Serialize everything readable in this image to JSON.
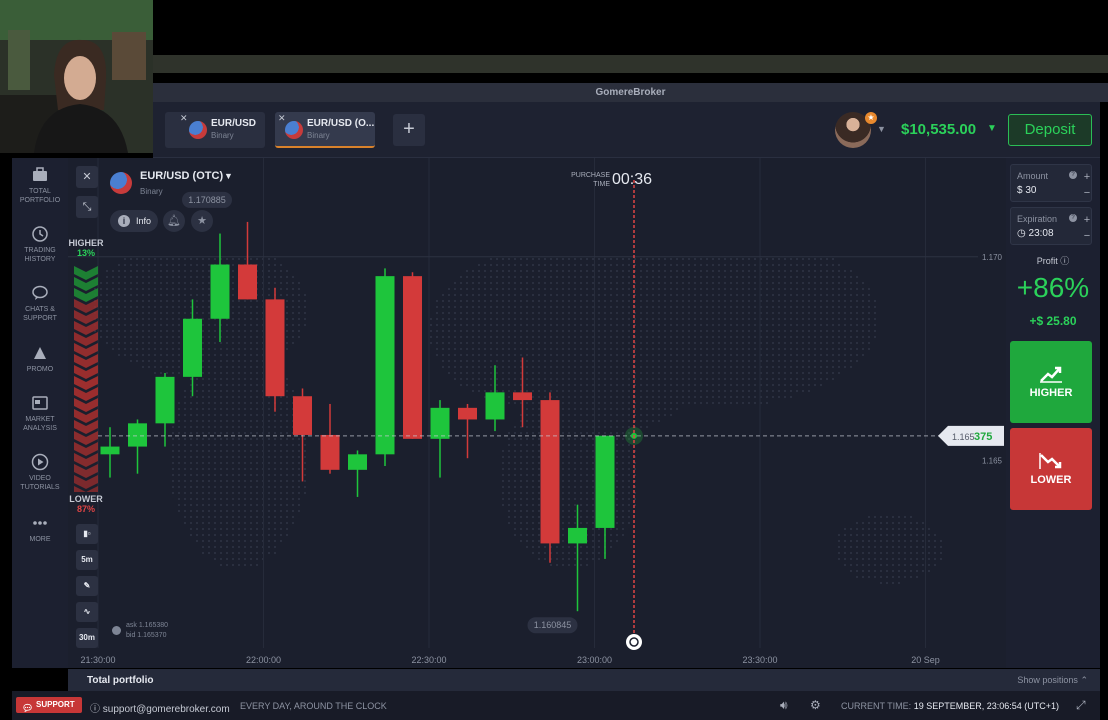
{
  "window": {
    "title": "GomereBroker"
  },
  "header": {
    "tabs": [
      {
        "name": "EUR/USD",
        "type": "Binary",
        "active": false
      },
      {
        "name": "EUR/USD (O...",
        "type": "Binary",
        "active": true
      }
    ],
    "add_tab_label": "+",
    "balance": "$10,535.00",
    "deposit_label": "Deposit"
  },
  "sidebar": {
    "items": [
      {
        "label": "TOTAL PORTFOLIO",
        "icon": "briefcase-icon"
      },
      {
        "label": "TRADING HISTORY",
        "icon": "history-icon"
      },
      {
        "label": "CHATS & SUPPORT",
        "icon": "chat-icon"
      },
      {
        "label": "PROMO",
        "icon": "promo-icon"
      },
      {
        "label": "MARKET ANALYSIS",
        "icon": "newspaper-icon"
      },
      {
        "label": "VIDEO TUTORIALS",
        "icon": "play-icon"
      },
      {
        "label": "MORE",
        "icon": "more-icon"
      }
    ]
  },
  "asset": {
    "name": "EUR/USD (OTC)",
    "type": "Binary",
    "info_label": "Info"
  },
  "sentiment": {
    "higher_label": "HIGHER",
    "higher_pct": "13%",
    "lower_label": "LOWER",
    "lower_pct": "87%",
    "higher_fraction": 0.13
  },
  "chart_tools": {
    "timeframes": [
      "5m",
      "30m"
    ]
  },
  "purchase": {
    "label": "PURCHASE TIME",
    "countdown": "00:36"
  },
  "quote": {
    "ask": "ask 1.165380",
    "bid": "bid 1.165370",
    "current_price_main": "1.165",
    "current_price_tail": "375"
  },
  "chart_data": {
    "type": "candlestick",
    "x_ticks": [
      "21:30:00",
      "22:00:00",
      "22:30:00",
      "23:00:00",
      "23:30:00",
      "20 Sep"
    ],
    "y_ticks": [
      "1.170",
      "1.165"
    ],
    "high_label": "1.170885",
    "low_label": "1.160845",
    "current_price": 1.165375,
    "candles": [
      {
        "o": 1.1649,
        "h": 1.1656,
        "l": 1.1643,
        "c": 1.1651
      },
      {
        "o": 1.1651,
        "h": 1.1658,
        "l": 1.1644,
        "c": 1.1657
      },
      {
        "o": 1.1657,
        "h": 1.167,
        "l": 1.1651,
        "c": 1.1669
      },
      {
        "o": 1.1669,
        "h": 1.1689,
        "l": 1.1664,
        "c": 1.1684
      },
      {
        "o": 1.1684,
        "h": 1.1706,
        "l": 1.1678,
        "c": 1.1698
      },
      {
        "o": 1.1698,
        "h": 1.1709,
        "l": 1.1689,
        "c": 1.1689
      },
      {
        "o": 1.1689,
        "h": 1.1692,
        "l": 1.166,
        "c": 1.1664
      },
      {
        "o": 1.1664,
        "h": 1.1666,
        "l": 1.1642,
        "c": 1.1654
      },
      {
        "o": 1.1654,
        "h": 1.1662,
        "l": 1.1644,
        "c": 1.1645
      },
      {
        "o": 1.1645,
        "h": 1.165,
        "l": 1.1638,
        "c": 1.1649
      },
      {
        "o": 1.1649,
        "h": 1.1697,
        "l": 1.1646,
        "c": 1.1695
      },
      {
        "o": 1.1695,
        "h": 1.1696,
        "l": 1.1653,
        "c": 1.1653
      },
      {
        "o": 1.1653,
        "h": 1.1663,
        "l": 1.1643,
        "c": 1.1661
      },
      {
        "o": 1.1661,
        "h": 1.1662,
        "l": 1.1648,
        "c": 1.1658
      },
      {
        "o": 1.1658,
        "h": 1.1672,
        "l": 1.1655,
        "c": 1.1665
      },
      {
        "o": 1.1665,
        "h": 1.1674,
        "l": 1.1656,
        "c": 1.1663
      },
      {
        "o": 1.1663,
        "h": 1.1665,
        "l": 1.1621,
        "c": 1.1626
      },
      {
        "o": 1.1626,
        "h": 1.1636,
        "l": 1.16085,
        "c": 1.163
      },
      {
        "o": 1.163,
        "h": 1.16538,
        "l": 1.1622,
        "c": 1.16538
      }
    ]
  },
  "trade_panel": {
    "amount_label": "Amount",
    "amount_value": "$ 30",
    "expiration_label": "Expiration",
    "expiration_value": "23:08",
    "profit_label": "Profit",
    "profit_pct": "+86%",
    "profit_amount": "+$ 25.80",
    "higher_label": "HIGHER",
    "lower_label": "LOWER"
  },
  "portfolio_bar": {
    "label": "Total portfolio",
    "show_positions": "Show positions"
  },
  "footer": {
    "support_label": "SUPPORT",
    "email": "support@gomerebroker.com",
    "hours": "EVERY DAY, AROUND THE CLOCK",
    "current_time_label": "CURRENT TIME:",
    "current_time_value": "19 SEPTEMBER, 23:06:54 (UTC+1)"
  },
  "colors": {
    "green": "#2bd15a",
    "red": "#e04545",
    "candle_green": "#1ec53c",
    "candle_red": "#d33a3a",
    "accent_orange": "#d9822b"
  }
}
